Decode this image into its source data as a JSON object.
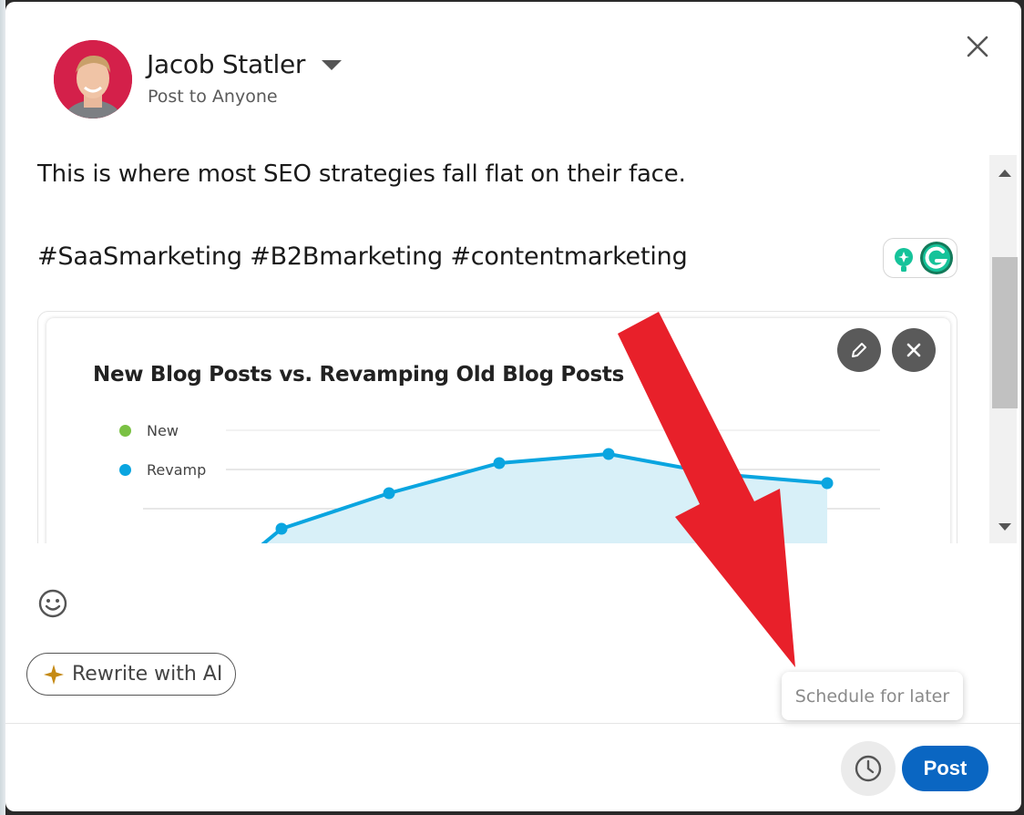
{
  "author": {
    "name": "Jacob Statler",
    "scope": "Post to Anyone"
  },
  "post": {
    "line1": "This is where most SEO strategies fall flat on their face.",
    "hashtags": "#SaaSmarketing #B2Bmarketing #contentmarketing"
  },
  "media": {
    "legend": [
      {
        "name": "New",
        "color": "#7ac143"
      },
      {
        "name": "Revamp",
        "color": "#0aa5e0"
      }
    ]
  },
  "chart_data": {
    "type": "area",
    "title": "New Blog Posts vs. Revamping Old Blog Posts",
    "series": [
      {
        "name": "Revamp",
        "color": "#0aa5e0"
      }
    ],
    "legend_position": "top-left",
    "grid": true
  },
  "actions": {
    "rewrite_label": "Rewrite with AI",
    "schedule_tooltip": "Schedule for later",
    "post_label": "Post"
  },
  "colors": {
    "primary": "#0a66c2",
    "annotation_arrow": "#e8202a"
  },
  "icons": [
    "chevron-down-icon",
    "close-icon",
    "grammarly-icon",
    "pencil-icon",
    "remove-icon",
    "emoji-icon",
    "sparkle-icon",
    "clock-icon"
  ]
}
